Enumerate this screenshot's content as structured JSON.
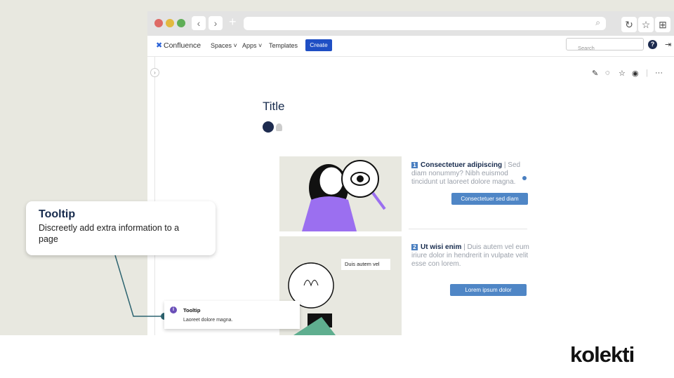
{
  "browser": {
    "controls": [
      "back",
      "forward",
      "new-tab"
    ]
  },
  "nav": {
    "product": "Confluence",
    "spaces": "Spaces",
    "apps": "Apps",
    "templates": "Templates",
    "create": "Create",
    "search_placeholder": "Search"
  },
  "page": {
    "title": "Title"
  },
  "cards": [
    {
      "num": "1",
      "heading": "Consectetuer adipiscing",
      "sep": " | ",
      "body": "Sed diam nonummy? Nibh euismod tincidunt ut laoreet dolore magna.",
      "button": "Consectetuer sed diam"
    },
    {
      "num": "2",
      "heading": "Ut wisi enim",
      "sep": " | ",
      "body": "Duis autem vel eum iriure dolor in hendrerit in vulpate velit esse con lorem.",
      "button": "Lorem ipsum dolor"
    }
  ],
  "illustration_label": "Duis autem vel",
  "callout": {
    "title": "Tooltip",
    "text": "Discreetly add extra information to a page"
  },
  "tooltip": {
    "title": "Tooltip",
    "text": "Laoreet dolore magna."
  },
  "brand": {
    "logo": "kolekti"
  },
  "colors": {
    "accent": "#1f4fc4",
    "button": "#4f86c6",
    "connector": "#2d6470"
  }
}
